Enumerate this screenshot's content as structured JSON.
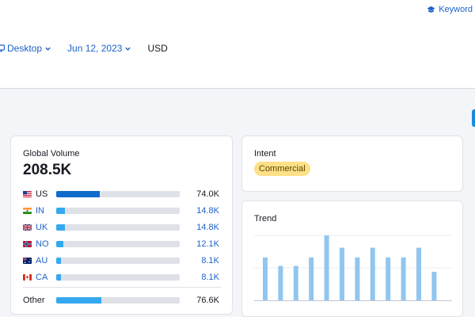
{
  "header": {
    "keyword_link": "Keyword R",
    "filters": {
      "device": "Desktop",
      "date": "Jun 12, 2023",
      "currency": "USD"
    }
  },
  "global_volume": {
    "title": "Global Volume",
    "total": "208.5K",
    "countries": [
      {
        "code": "US",
        "value": "74.0K",
        "share": 0.355
      },
      {
        "code": "IN",
        "value": "14.8K",
        "share": 0.071
      },
      {
        "code": "UK",
        "value": "14.8K",
        "share": 0.071
      },
      {
        "code": "NO",
        "value": "12.1K",
        "share": 0.058
      },
      {
        "code": "AU",
        "value": "8.1K",
        "share": 0.039
      },
      {
        "code": "CA",
        "value": "8.1K",
        "share": 0.039
      }
    ],
    "other": {
      "label": "Other",
      "value": "76.6K",
      "share": 0.367
    }
  },
  "intent": {
    "title": "Intent",
    "badge": "Commercial"
  },
  "trend": {
    "title": "Trend",
    "chart_data": {
      "type": "bar",
      "values": [
        66,
        53,
        53,
        66,
        100,
        81,
        66,
        81,
        66,
        66,
        81,
        44
      ],
      "ylim": [
        0,
        100
      ]
    }
  },
  "colors": {
    "accent": "#1d62c8",
    "bar_light": "#35a9ef",
    "bar_dark": "#0f6ccc",
    "trend_bar": "#90c6ef",
    "badge": "#fde087"
  }
}
